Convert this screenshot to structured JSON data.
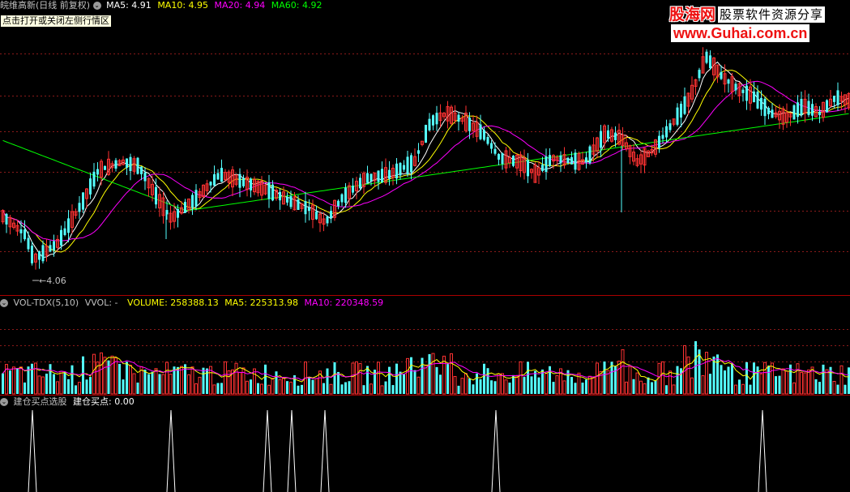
{
  "price_panel": {
    "title": "皖维高新(日线 前复权)",
    "ma5": "MA5: 4.91",
    "ma10": "MA10: 4.95",
    "ma20": "MA20: 4.94",
    "ma60": "MA60: 4.92",
    "low_marker": "←4.06",
    "tooltip": "点击打开或关闭左侧行情区"
  },
  "volume_panel": {
    "title": "VOL-TDX(5,10)",
    "vvol": "VVOL: -",
    "volume": "VOLUME: 258388.13",
    "ma5": "MA5: 225313.98",
    "ma10": "MA10: 220348.59"
  },
  "signal_panel": {
    "title": "建仓买点选股",
    "value": "建仓买点: 0.00"
  },
  "logo": {
    "brand": "股海网",
    "tagline": "股票软件资源分享",
    "url": "www.Guhai.com.cn"
  },
  "colors": {
    "background": "#000000",
    "up": "#ff3232",
    "down": "#54ffff",
    "ma5": "#ffffff",
    "ma10": "#ffff00",
    "ma20": "#ff00ff",
    "ma60": "#00ff00",
    "grid": "#8b1a1a",
    "separator": "#aa0000"
  },
  "icons": [
    "collapse-circle-icon"
  ]
}
